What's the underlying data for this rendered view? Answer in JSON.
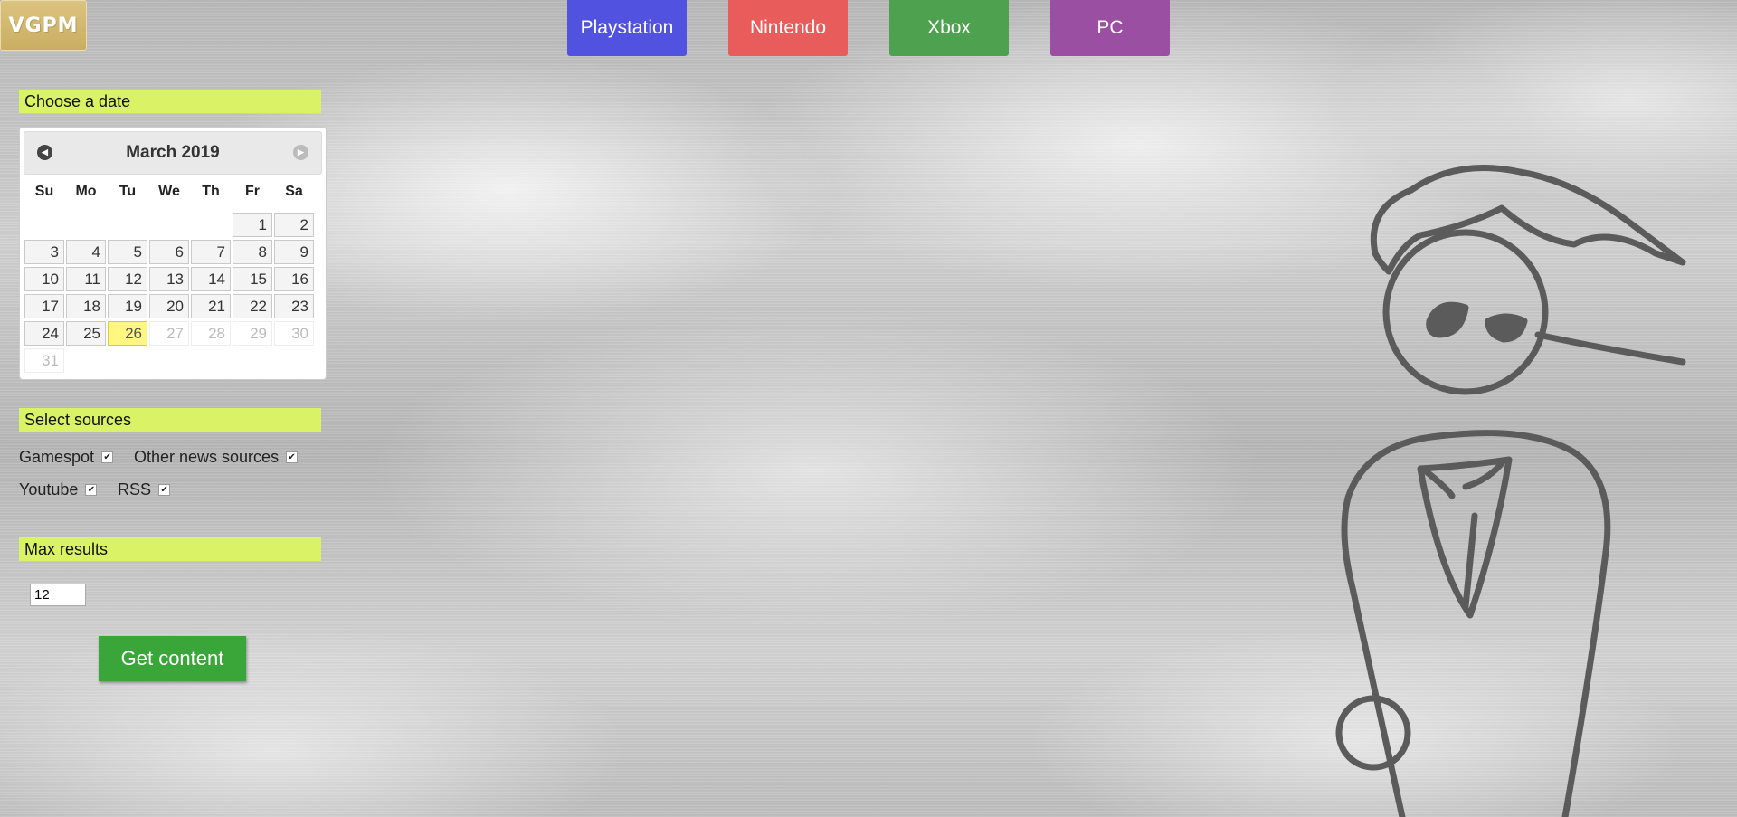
{
  "logo": {
    "text": "VGPM"
  },
  "nav": [
    {
      "label": "Playstation",
      "color": "#5252e0"
    },
    {
      "label": "Nintendo",
      "color": "#e95c5c"
    },
    {
      "label": "Xbox",
      "color": "#4ea14e"
    },
    {
      "label": "PC",
      "color": "#9b4fa3"
    }
  ],
  "date_section": {
    "label": "Choose a date",
    "calendar": {
      "month_label": "March 2019",
      "weekdays": [
        "Su",
        "Mo",
        "Tu",
        "We",
        "Th",
        "Fr",
        "Sa"
      ],
      "weeks": [
        [
          "",
          "",
          "",
          "",
          "",
          "1",
          "2"
        ],
        [
          "3",
          "4",
          "5",
          "6",
          "7",
          "8",
          "9"
        ],
        [
          "10",
          "11",
          "12",
          "13",
          "14",
          "15",
          "16"
        ],
        [
          "17",
          "18",
          "19",
          "20",
          "21",
          "22",
          "23"
        ],
        [
          "24",
          "25",
          "26",
          "27",
          "28",
          "29",
          "30"
        ],
        [
          "31",
          "",
          "",
          "",
          "",
          "",
          ""
        ]
      ],
      "today": "26",
      "disabled": [
        "27",
        "28",
        "29",
        "30",
        "31"
      ]
    }
  },
  "sources_section": {
    "label": "Select sources",
    "sources": [
      {
        "label": "Gamespot",
        "checked": true
      },
      {
        "label": "Other news sources",
        "checked": true
      },
      {
        "label": "Youtube",
        "checked": true
      },
      {
        "label": "RSS",
        "checked": true
      }
    ]
  },
  "max_section": {
    "label": "Max results",
    "value": "12"
  },
  "submit": {
    "label": "Get content",
    "color": "#3aa63a"
  }
}
